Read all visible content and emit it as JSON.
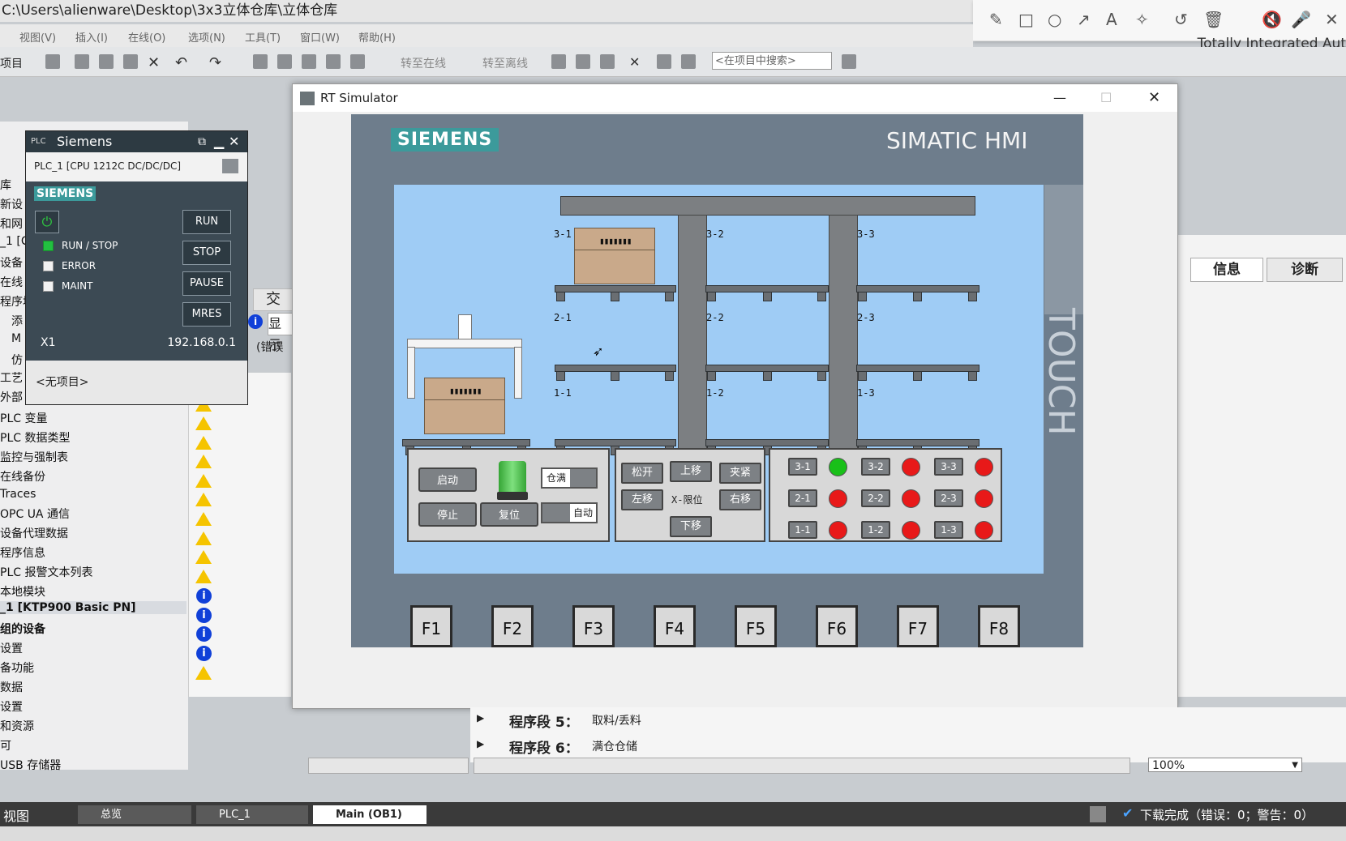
{
  "window_title": "C:\\Users\\alienware\\Desktop\\3x3立体仓库\\立体仓库",
  "brand_text": "Totally Integrated Aut",
  "menu": [
    "视图(V)",
    "插入(I)",
    "在线(O)",
    "选项(N)",
    "工具(T)",
    "窗口(W)",
    "帮助(H)"
  ],
  "toolbar": {
    "project_label": "项目",
    "go_online": "转至在线",
    "go_offline": "转至离线",
    "search_placeholder": "<在项目中搜索>"
  },
  "left_tree": [
    "库",
    "新设",
    "和网",
    "_1 [C",
    "设备",
    "在线",
    "程序块",
    "添",
    "M",
    "仿",
    "工艺",
    "外部",
    "PLC 变量",
    "PLC 数据类型",
    "监控与强制表",
    "在线备份",
    "Traces",
    "OPC UA 通信",
    "设备代理数据",
    "程序信息",
    "PLC 报警文本列表",
    "本地模块",
    "_1 [KTP900 Basic PN]",
    "组的设备",
    "设置",
    "备功能",
    "数据",
    "设置",
    "和资源",
    "可",
    "USB 存储器"
  ],
  "right_tabs": {
    "info": "信息",
    "diag": "诊断"
  },
  "tab_partial": {
    "cross": "交",
    "show": "显示",
    "error": "(错误"
  },
  "plcsim": {
    "title": "Siemens",
    "plc": "PLC_1 [CPU 1212C DC/DC/DC]",
    "brand": "SIEMENS",
    "run": "RUN",
    "stop": "STOP",
    "pause": "PAUSE",
    "mres": "MRES",
    "led_runstop": "RUN / STOP",
    "led_error": "ERROR",
    "led_maint": "MAINT",
    "port": "X1",
    "ip": "192.168.0.1",
    "project": "<无项目>"
  },
  "rt": {
    "title": "RT Simulator",
    "logo": "SIEMENS",
    "hmi_title": "SIMATIC HMI",
    "touch": "TOUCH"
  },
  "cells": {
    "c31": "3-1",
    "c32": "3-2",
    "c33": "3-3",
    "c21": "2-1",
    "c22": "2-2",
    "c23": "2-3",
    "c11": "1-1",
    "c12": "1-2",
    "c13": "1-3"
  },
  "controls": {
    "start": "启动",
    "stop": "停止",
    "reset": "复位",
    "full": "仓满",
    "auto": "自动"
  },
  "motion": {
    "loosen": "松开",
    "up": "上移",
    "clamp": "夹紧",
    "left": "左移",
    "xlimit": "X-限位",
    "right": "右移",
    "down": "下移"
  },
  "lamps": [
    {
      "label": "3-1",
      "color": "#19c019"
    },
    {
      "label": "3-2",
      "color": "#e81919"
    },
    {
      "label": "3-3",
      "color": "#e81919"
    },
    {
      "label": "2-1",
      "color": "#e81919"
    },
    {
      "label": "2-2",
      "color": "#e81919"
    },
    {
      "label": "2-3",
      "color": "#e81919"
    },
    {
      "label": "1-1",
      "color": "#e81919"
    },
    {
      "label": "1-2",
      "color": "#e81919"
    },
    {
      "label": "1-3",
      "color": "#e81919"
    }
  ],
  "fkeys": [
    "F1",
    "F2",
    "F3",
    "F4",
    "F5",
    "F6",
    "F7",
    "F8"
  ],
  "program": {
    "seg5_label": "程序段 5：",
    "seg5_text": "取料/丢料",
    "seg6_label": "程序段 6：",
    "seg6_text": "满仓仓储"
  },
  "zoom": "100%",
  "taskbar": {
    "view": "视图",
    "overview": "总览",
    "plc": "PLC_1",
    "main": "Main (OB1)",
    "status": "下载完成（错误：0；警告：0）"
  },
  "accent_colors": {
    "siemens_teal": "#3c9a9b",
    "hmi_bezel": "#6e7d8c",
    "screen_bg": "#9fccf5"
  }
}
